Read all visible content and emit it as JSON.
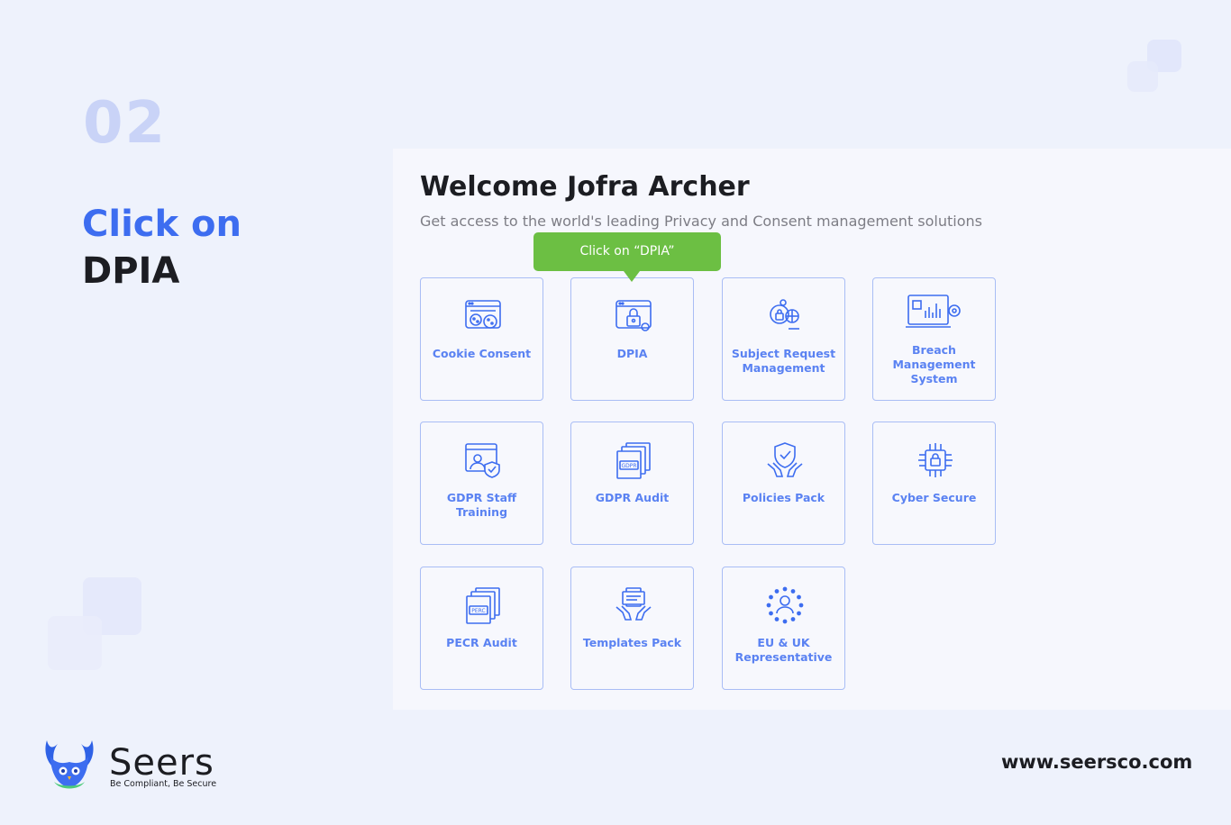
{
  "step": {
    "number": "02",
    "line1": "Click on",
    "line2": "DPIA"
  },
  "panel": {
    "welcome": "Welcome Jofra Archer",
    "subtitle": "Get access to the world's leading Privacy and Consent management solutions"
  },
  "tooltip": {
    "text": "Click on “DPIA”"
  },
  "cards": [
    {
      "label": "Cookie Consent",
      "icon": "cookie-consent-icon"
    },
    {
      "label": "DPIA",
      "icon": "dpia-lock-icon"
    },
    {
      "label": "Subject Request Management",
      "icon": "subject-request-icon"
    },
    {
      "label": "Breach Management System",
      "icon": "breach-management-icon"
    },
    {
      "label": "GDPR Staff Training",
      "icon": "staff-training-icon"
    },
    {
      "label": "GDPR Audit",
      "icon": "gdpr-audit-icon"
    },
    {
      "label": "Policies Pack",
      "icon": "policies-shield-icon"
    },
    {
      "label": "Cyber Secure",
      "icon": "cyber-secure-icon"
    },
    {
      "label": "PECR Audit",
      "icon": "pecr-audit-icon"
    },
    {
      "label": "Templates Pack",
      "icon": "templates-pack-icon"
    },
    {
      "label": "EU & UK Representative",
      "icon": "eu-uk-representative-icon"
    }
  ],
  "icon_labels": {
    "gdpr": "GDPR",
    "pecr": "PERC"
  },
  "brand": {
    "name": "Seers",
    "tagline": "Be Compliant, Be Secure",
    "website": "www.seersco.com"
  },
  "colors": {
    "accent": "#3d6df0",
    "card_text": "#5a82f2",
    "tooltip": "#6cbf43",
    "background": "#eef2fc"
  }
}
